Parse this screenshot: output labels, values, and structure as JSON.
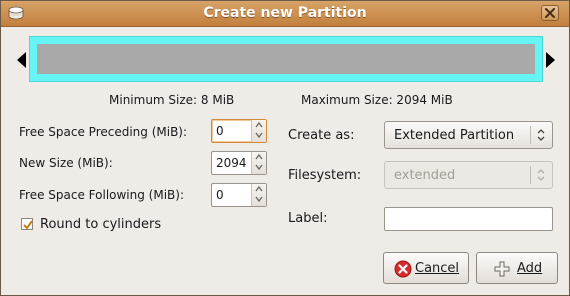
{
  "window": {
    "title": "Create new Partition",
    "icons": {
      "app": "disk-icon",
      "close": "close-icon"
    }
  },
  "partition_preview": {
    "frame_color": "#66f4f4",
    "fill_color": "#a9a9a9",
    "min_size_label": "Minimum Size: 8 MiB",
    "max_size_label": "Maximum Size: 2094 MiB"
  },
  "form": {
    "free_preceding": {
      "label": "Free Space Preceding (MiB):",
      "value": "0"
    },
    "new_size": {
      "label": "New Size (MiB):",
      "value": "2094"
    },
    "free_following": {
      "label": "Free Space Following (MiB):",
      "value": "0"
    },
    "round_cylinders": {
      "label": "Round to cylinders",
      "checked": true
    },
    "create_as": {
      "label": "Create as:",
      "value": "Extended Partition"
    },
    "filesystem": {
      "label": "Filesystem:",
      "value": "extended",
      "disabled": true
    },
    "partition_label": {
      "label": "Label:",
      "value": ""
    }
  },
  "buttons": {
    "cancel": {
      "label": "Cancel",
      "icon": "cancel-icon",
      "color": "#d52b2b"
    },
    "add": {
      "label": "Add",
      "icon": "add-icon"
    }
  },
  "colors": {
    "titlebar": "#c98a48",
    "focus": "#d28b3c",
    "check": "#c77a1d"
  }
}
